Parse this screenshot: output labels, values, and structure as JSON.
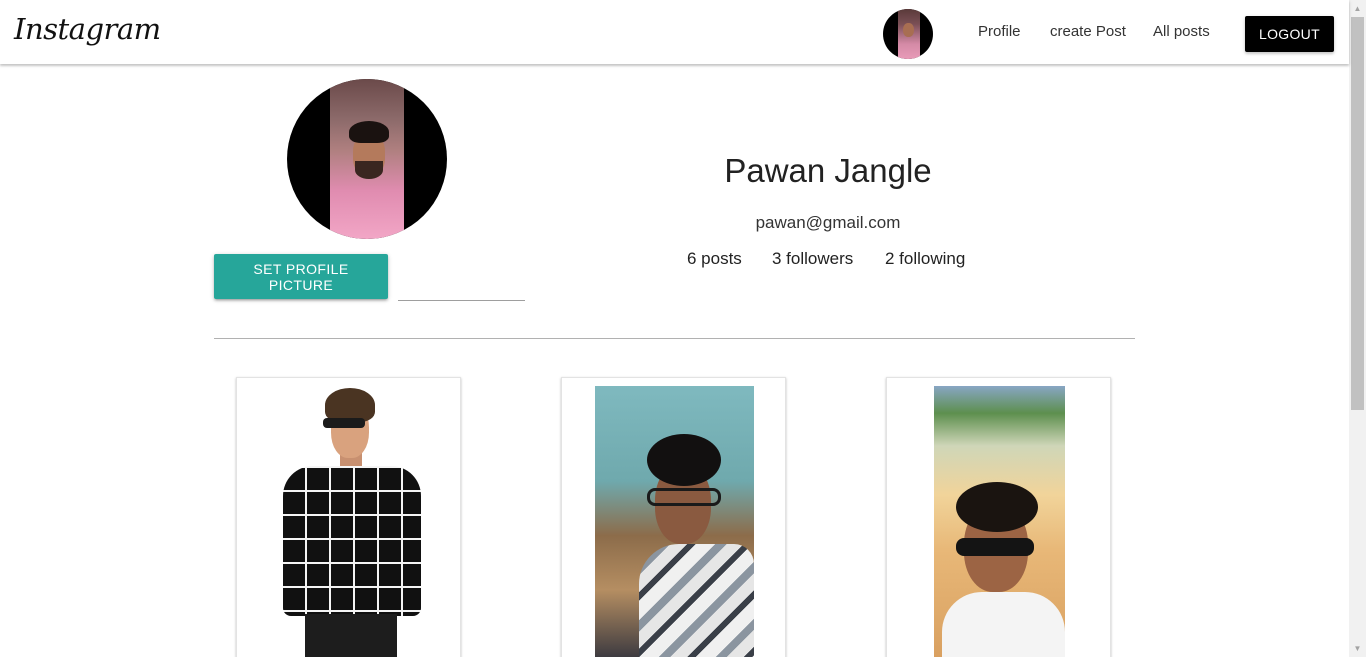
{
  "navbar": {
    "brand": "Instagram",
    "links": [
      "Profile",
      "create Post",
      "All posts"
    ],
    "logout_label": "LOGOUT"
  },
  "profile": {
    "name": "Pawan Jangle",
    "email": "pawan@gmail.com",
    "stats": {
      "posts": "6 posts",
      "followers": "3 followers",
      "following": "2 following"
    },
    "set_picture_label": "SET PROFILE PICTURE",
    "file_path_placeholder": ""
  },
  "posts": [
    {
      "subject": "man in black grid sweater"
    },
    {
      "subject": "selfie with curly hair and glasses"
    },
    {
      "subject": "outdoor selfie with sunglasses"
    }
  ],
  "colors": {
    "accent": "#26a69a",
    "logout_bg": "#000000",
    "navbar_bg": "#ffffff"
  },
  "icons": {
    "scroll_up": "triangle-up",
    "scroll_down": "triangle-down"
  }
}
